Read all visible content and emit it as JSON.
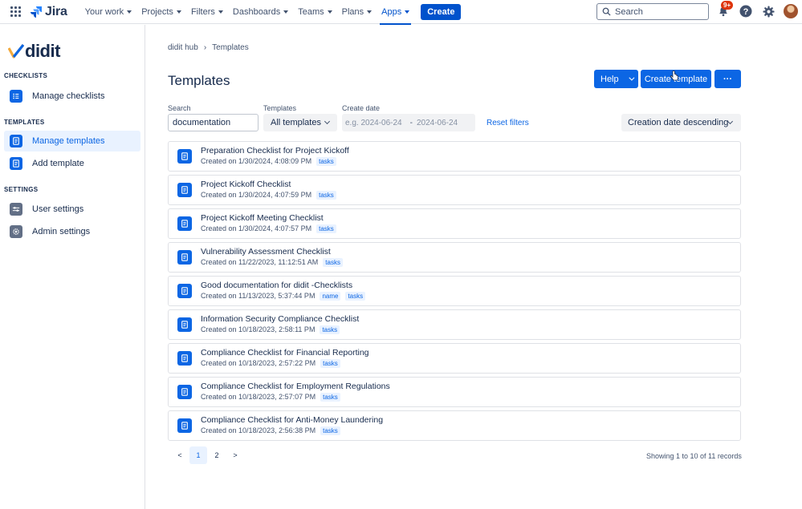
{
  "topnav": {
    "product": "Jira",
    "items": [
      {
        "label": "Your work"
      },
      {
        "label": "Projects"
      },
      {
        "label": "Filters"
      },
      {
        "label": "Dashboards"
      },
      {
        "label": "Teams"
      },
      {
        "label": "Plans"
      },
      {
        "label": "Apps"
      }
    ],
    "active_item": "Apps",
    "create_label": "Create",
    "search_placeholder": "Search",
    "notifications_badge": "9+"
  },
  "sidebar": {
    "logo_text": "didit",
    "sections": [
      {
        "title": "CHECKLISTS",
        "items": [
          {
            "label": "Manage checklists",
            "icon": "list-icon"
          }
        ]
      },
      {
        "title": "TEMPLATES",
        "items": [
          {
            "label": "Manage templates",
            "icon": "template-icon",
            "selected": true
          },
          {
            "label": "Add template",
            "icon": "template-icon"
          }
        ]
      },
      {
        "title": "SETTINGS",
        "items": [
          {
            "label": "User settings",
            "icon": "sliders-icon"
          },
          {
            "label": "Admin settings",
            "icon": "gear-icon"
          }
        ]
      }
    ]
  },
  "main": {
    "breadcrumb": {
      "root": "didit hub",
      "current": "Templates"
    },
    "title": "Templates",
    "buttons": {
      "help": "Help",
      "create_template": "Create template",
      "more": "···"
    },
    "filters": {
      "search_label": "Search",
      "search_value": "documentation",
      "templates_label": "Templates",
      "templates_value": "All templates",
      "date_label": "Create date",
      "date_from_placeholder": "e.g. 2024-06-24",
      "date_to_placeholder": "2024-06-24",
      "reset_label": "Reset filters",
      "sort_value": "Creation date descending"
    },
    "templates": [
      {
        "title": "Preparation Checklist for Project Kickoff",
        "created": "Created on 1/30/2024, 4:08:09 PM",
        "tags": [
          "tasks"
        ]
      },
      {
        "title": "Project Kickoff Checklist",
        "created": "Created on 1/30/2024, 4:07:59 PM",
        "tags": [
          "tasks"
        ]
      },
      {
        "title": "Project Kickoff Meeting Checklist",
        "created": "Created on 1/30/2024, 4:07:57 PM",
        "tags": [
          "tasks"
        ]
      },
      {
        "title": "Vulnerability Assessment Checklist",
        "created": "Created on 11/22/2023, 11:12:51 AM",
        "tags": [
          "tasks"
        ]
      },
      {
        "title": "Good documentation for didit -Checklists",
        "created": "Created on 11/13/2023, 5:37:44 PM",
        "tags": [
          "name",
          "tasks"
        ]
      },
      {
        "title": "Information Security Compliance Checklist",
        "created": "Created on 10/18/2023, 2:58:11 PM",
        "tags": [
          "tasks"
        ]
      },
      {
        "title": "Compliance Checklist for Financial Reporting",
        "created": "Created on 10/18/2023, 2:57:22 PM",
        "tags": [
          "tasks"
        ]
      },
      {
        "title": "Compliance Checklist for Employment Regulations",
        "created": "Created on 10/18/2023, 2:57:07 PM",
        "tags": [
          "tasks"
        ]
      },
      {
        "title": "Compliance Checklist for Anti-Money Laundering",
        "created": "Created on 10/18/2023, 2:56:38 PM",
        "tags": [
          "tasks"
        ]
      }
    ],
    "pagination": {
      "prev": "<",
      "pages": [
        "1",
        "2"
      ],
      "current": "1",
      "next": ">",
      "summary": "Showing 1 to 10 of 11 records"
    }
  },
  "colors": {
    "brand": "#0c66e4",
    "jira_blue": "#0052cc",
    "badge": "#de350b"
  }
}
